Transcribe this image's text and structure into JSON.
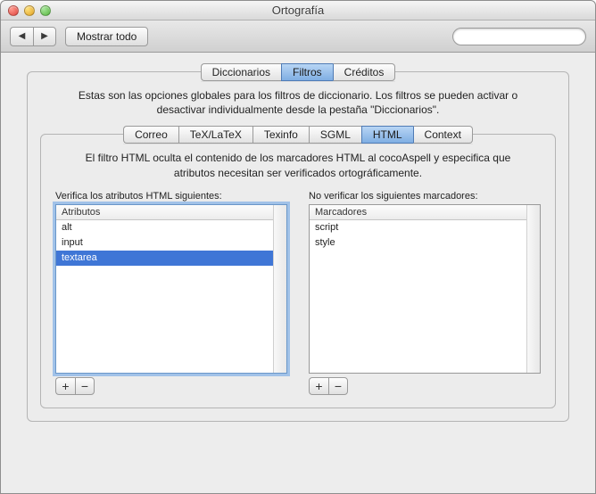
{
  "window": {
    "title": "Ortografía"
  },
  "toolbar": {
    "back_icon": "◀",
    "forward_icon": "▶",
    "show_all": "Mostrar todo",
    "search_placeholder": ""
  },
  "tabs_top": {
    "items": [
      {
        "label": "Diccionarios",
        "active": false
      },
      {
        "label": "Filtros",
        "active": true
      },
      {
        "label": "Créditos",
        "active": false
      }
    ]
  },
  "description": "Estas son las opciones globales para los filtros de diccionario. Los filtros se pueden activar o desactivar individualmente desde la pestaña \"Diccionarios\".",
  "tabs_inner": {
    "items": [
      {
        "label": "Correo",
        "active": false
      },
      {
        "label": "TeX/LaTeX",
        "active": false
      },
      {
        "label": "Texinfo",
        "active": false
      },
      {
        "label": "SGML",
        "active": false
      },
      {
        "label": "HTML",
        "active": true
      },
      {
        "label": "Context",
        "active": false
      }
    ]
  },
  "sub_description": "El filtro HTML oculta el contenido de los marcadores HTML al cocoAspell y especifica que atributos necesitan ser verificados ortográficamente.",
  "left": {
    "caption": "Verifica los atributos HTML siguientes:",
    "header": "Atributos",
    "rows": [
      {
        "label": "alt",
        "selected": false
      },
      {
        "label": "input",
        "selected": false
      },
      {
        "label": "textarea",
        "selected": true
      }
    ]
  },
  "right": {
    "caption": "No verificar los siguientes marcadores:",
    "header": "Marcadores",
    "rows": [
      {
        "label": "script",
        "selected": false
      },
      {
        "label": "style",
        "selected": false
      }
    ]
  },
  "buttons": {
    "add": "+",
    "remove": "−"
  }
}
